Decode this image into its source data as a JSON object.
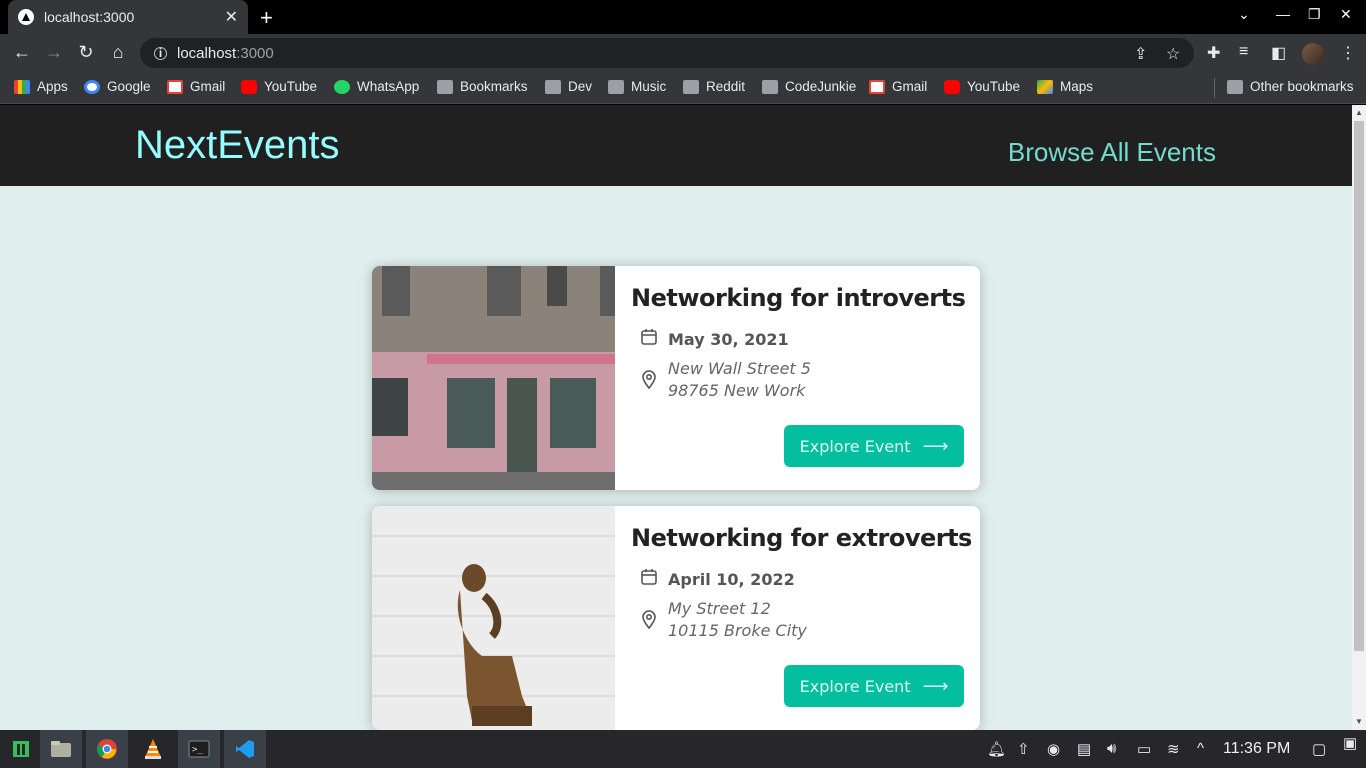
{
  "browser": {
    "tab_title": "localhost:3000",
    "url_host": "localhost",
    "url_port": ":3000"
  },
  "bookmarks": [
    {
      "label": "Apps",
      "icon": "apps-grid-icon"
    },
    {
      "label": "Google",
      "icon": "google-icon"
    },
    {
      "label": "Gmail",
      "icon": "gmail-icon"
    },
    {
      "label": "YouTube",
      "icon": "youtube-icon"
    },
    {
      "label": "WhatsApp",
      "icon": "whatsapp-icon"
    },
    {
      "label": "Bookmarks",
      "icon": "folder-icon"
    },
    {
      "label": "Dev",
      "icon": "folder-icon"
    },
    {
      "label": "Music",
      "icon": "folder-icon"
    },
    {
      "label": "Reddit",
      "icon": "folder-icon"
    },
    {
      "label": "CodeJunkie",
      "icon": "folder-icon"
    },
    {
      "label": "Gmail",
      "icon": "gmail-icon"
    },
    {
      "label": "YouTube",
      "icon": "youtube-icon"
    },
    {
      "label": "Maps",
      "icon": "maps-icon"
    }
  ],
  "other_bookmarks": "Other bookmarks",
  "site": {
    "logo": "NextEvents",
    "nav_link": "Browse All Events"
  },
  "events": [
    {
      "title": "Networking for introverts",
      "date": "May 30, 2021",
      "address_line1": "New Wall Street 5",
      "address_line2": "98765 New Work",
      "button": "Explore Event"
    },
    {
      "title": "Networking for extroverts",
      "date": "April 10, 2022",
      "address_line1": "My Street 12",
      "address_line2": "10115 Broke City",
      "button": "Explore Event"
    }
  ],
  "taskbar": {
    "clock": "11:36 PM"
  },
  "colors": {
    "header_bg": "#202020",
    "logo": "#94fdfd",
    "nav_link": "#74dacc",
    "page_bg": "#e0efee",
    "button_bg": "#03be9f"
  }
}
